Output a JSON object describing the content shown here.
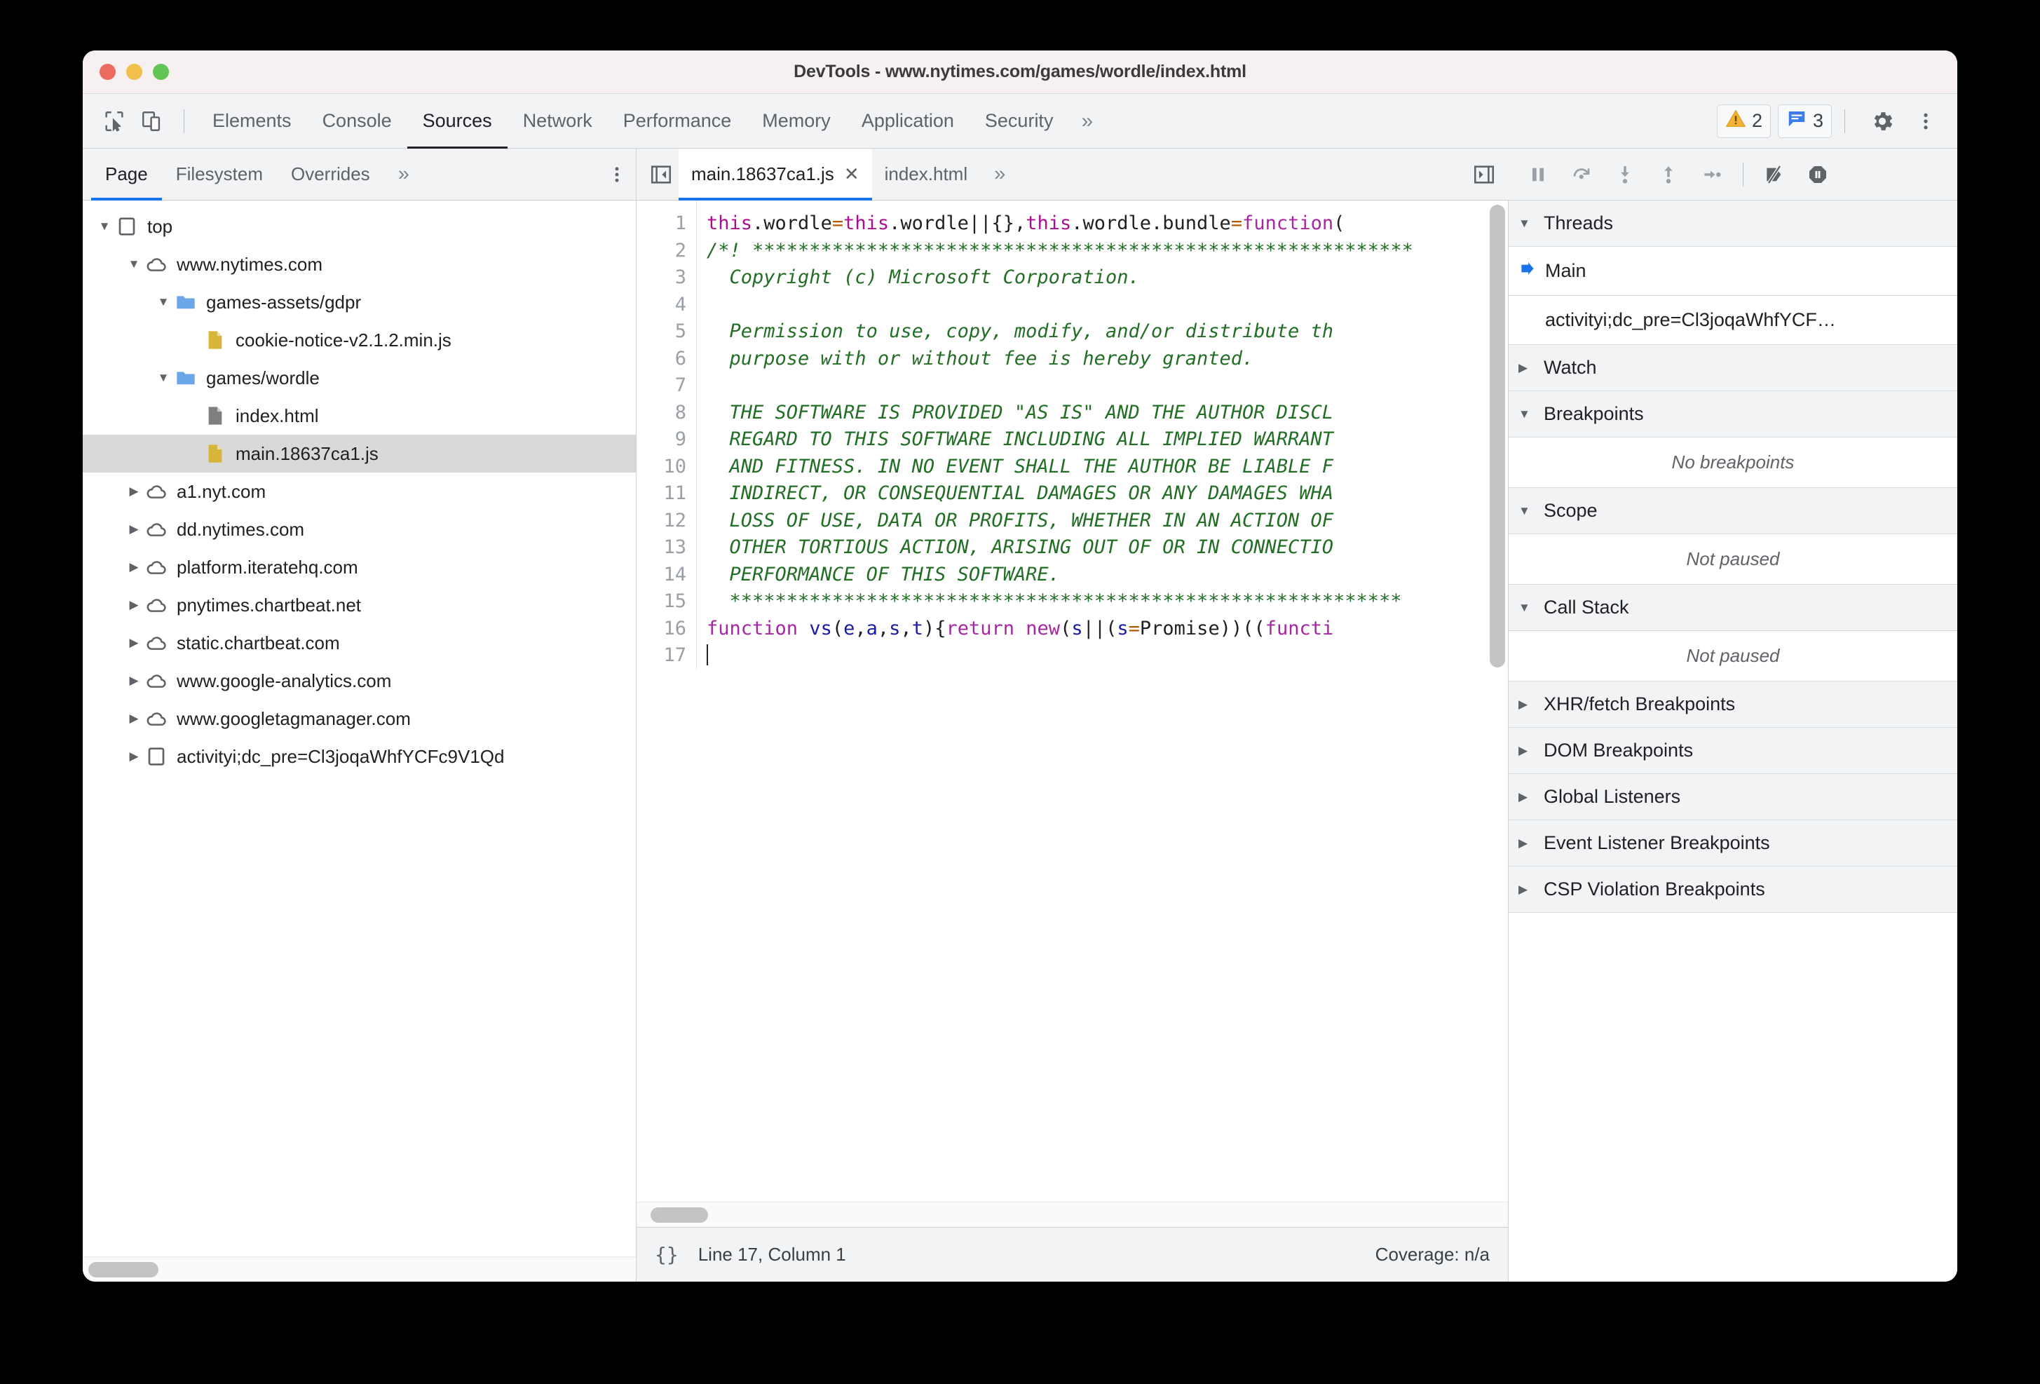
{
  "window": {
    "title": "DevTools - www.nytimes.com/games/wordle/index.html"
  },
  "main_tabs": {
    "inspect_icon": "inspect-cursor-icon",
    "device_icon": "device-toolbar-icon",
    "items": [
      {
        "label": "Elements",
        "active": false
      },
      {
        "label": "Console",
        "active": false
      },
      {
        "label": "Sources",
        "active": true
      },
      {
        "label": "Network",
        "active": false
      },
      {
        "label": "Performance",
        "active": false
      },
      {
        "label": "Memory",
        "active": false
      },
      {
        "label": "Application",
        "active": false
      },
      {
        "label": "Security",
        "active": false
      }
    ],
    "more_label": "»",
    "warning_count": "2",
    "message_count": "3",
    "settings_icon": "gear-icon",
    "more_options_icon": "kebab-menu-icon"
  },
  "navigator": {
    "tabs": [
      {
        "label": "Page",
        "active": true
      },
      {
        "label": "Filesystem",
        "active": false
      },
      {
        "label": "Overrides",
        "active": false
      },
      {
        "label": "»",
        "active": false
      }
    ],
    "more_options_icon": "kebab-menu-icon",
    "tree": [
      {
        "label": "top",
        "icon": "frame-icon",
        "twisty": "down",
        "indent": 0,
        "selected": false
      },
      {
        "label": "www.nytimes.com",
        "icon": "cloud-icon",
        "twisty": "down",
        "indent": 1,
        "selected": false
      },
      {
        "label": "games-assets/gdpr",
        "icon": "folder-icon",
        "twisty": "down",
        "indent": 2,
        "selected": false
      },
      {
        "label": "cookie-notice-v2.1.2.min.js",
        "icon": "js-file-icon",
        "twisty": "none",
        "indent": 3,
        "selected": false
      },
      {
        "label": "games/wordle",
        "icon": "folder-icon",
        "twisty": "down",
        "indent": 2,
        "selected": false
      },
      {
        "label": "index.html",
        "icon": "html-file-icon",
        "twisty": "none",
        "indent": 3,
        "selected": false
      },
      {
        "label": "main.18637ca1.js",
        "icon": "js-file-icon",
        "twisty": "none",
        "indent": 3,
        "selected": true
      },
      {
        "label": "a1.nyt.com",
        "icon": "cloud-icon",
        "twisty": "right",
        "indent": 1,
        "selected": false
      },
      {
        "label": "dd.nytimes.com",
        "icon": "cloud-icon",
        "twisty": "right",
        "indent": 1,
        "selected": false
      },
      {
        "label": "platform.iteratehq.com",
        "icon": "cloud-icon",
        "twisty": "right",
        "indent": 1,
        "selected": false
      },
      {
        "label": "pnytimes.chartbeat.net",
        "icon": "cloud-icon",
        "twisty": "right",
        "indent": 1,
        "selected": false
      },
      {
        "label": "static.chartbeat.com",
        "icon": "cloud-icon",
        "twisty": "right",
        "indent": 1,
        "selected": false
      },
      {
        "label": "www.google-analytics.com",
        "icon": "cloud-icon",
        "twisty": "right",
        "indent": 1,
        "selected": false
      },
      {
        "label": "www.googletagmanager.com",
        "icon": "cloud-icon",
        "twisty": "right",
        "indent": 1,
        "selected": false
      },
      {
        "label": "activityi;dc_pre=Cl3joqaWhfYCFc9V1Qd",
        "icon": "frame-icon",
        "twisty": "right",
        "indent": 1,
        "selected": false
      }
    ]
  },
  "editor": {
    "prev_icon": "show-navigator-icon",
    "next_icon": "show-debugger-icon",
    "tabs": [
      {
        "label": "main.18637ca1.js",
        "active": true,
        "closable": true
      },
      {
        "label": "index.html",
        "active": false,
        "closable": false
      }
    ],
    "more_label": "»",
    "code_lines": [
      {
        "n": "1",
        "tokens": [
          {
            "t": "this",
            "c": "k"
          },
          {
            "t": ".wordle",
            "c": "pl"
          },
          {
            "t": "=",
            "c": "op"
          },
          {
            "t": "this",
            "c": "k"
          },
          {
            "t": ".wordle",
            "c": "pl"
          },
          {
            "t": "||{},",
            "c": "pl"
          },
          {
            "t": "this",
            "c": "k"
          },
          {
            "t": ".wordle.bundle",
            "c": "pl"
          },
          {
            "t": "=",
            "c": "op"
          },
          {
            "t": "function",
            "c": "kk"
          },
          {
            "t": "(",
            "c": "pl"
          }
        ]
      },
      {
        "n": "2",
        "tokens": [
          {
            "t": "/*! **********************************************************",
            "c": "cm"
          }
        ]
      },
      {
        "n": "3",
        "tokens": [
          {
            "t": "  Copyright (c) Microsoft Corporation.",
            "c": "cm"
          }
        ]
      },
      {
        "n": "4",
        "tokens": [
          {
            "t": "",
            "c": "cm"
          }
        ]
      },
      {
        "n": "5",
        "tokens": [
          {
            "t": "  Permission to use, copy, modify, and/or distribute th",
            "c": "cm"
          }
        ]
      },
      {
        "n": "6",
        "tokens": [
          {
            "t": "  purpose with or without fee is hereby granted.",
            "c": "cm"
          }
        ]
      },
      {
        "n": "7",
        "tokens": [
          {
            "t": "",
            "c": "cm"
          }
        ]
      },
      {
        "n": "8",
        "tokens": [
          {
            "t": "  THE SOFTWARE IS PROVIDED \"AS IS\" AND THE AUTHOR DISCL",
            "c": "cm"
          }
        ]
      },
      {
        "n": "9",
        "tokens": [
          {
            "t": "  REGARD TO THIS SOFTWARE INCLUDING ALL IMPLIED WARRANT",
            "c": "cm"
          }
        ]
      },
      {
        "n": "10",
        "tokens": [
          {
            "t": "  AND FITNESS. IN NO EVENT SHALL THE AUTHOR BE LIABLE F",
            "c": "cm"
          }
        ]
      },
      {
        "n": "11",
        "tokens": [
          {
            "t": "  INDIRECT, OR CONSEQUENTIAL DAMAGES OR ANY DAMAGES WHA",
            "c": "cm"
          }
        ]
      },
      {
        "n": "12",
        "tokens": [
          {
            "t": "  LOSS OF USE, DATA OR PROFITS, WHETHER IN AN ACTION OF",
            "c": "cm"
          }
        ]
      },
      {
        "n": "13",
        "tokens": [
          {
            "t": "  OTHER TORTIOUS ACTION, ARISING OUT OF OR IN CONNECTIO",
            "c": "cm"
          }
        ]
      },
      {
        "n": "14",
        "tokens": [
          {
            "t": "  PERFORMANCE OF THIS SOFTWARE.",
            "c": "cm"
          }
        ]
      },
      {
        "n": "15",
        "tokens": [
          {
            "t": "  ***********************************************************",
            "c": "cm"
          }
        ]
      },
      {
        "n": "16",
        "tokens": [
          {
            "t": "function",
            "c": "kk"
          },
          {
            "t": " ",
            "c": "pl"
          },
          {
            "t": "vs",
            "c": "var"
          },
          {
            "t": "(",
            "c": "pl"
          },
          {
            "t": "e",
            "c": "var"
          },
          {
            "t": ",",
            "c": "pl"
          },
          {
            "t": "a",
            "c": "var"
          },
          {
            "t": ",",
            "c": "pl"
          },
          {
            "t": "s",
            "c": "var"
          },
          {
            "t": ",",
            "c": "pl"
          },
          {
            "t": "t",
            "c": "var"
          },
          {
            "t": "){",
            "c": "pl"
          },
          {
            "t": "return",
            "c": "kk"
          },
          {
            "t": " ",
            "c": "pl"
          },
          {
            "t": "new",
            "c": "kk"
          },
          {
            "t": "(",
            "c": "pl"
          },
          {
            "t": "s",
            "c": "var"
          },
          {
            "t": "||(",
            "c": "pl"
          },
          {
            "t": "s",
            "c": "var"
          },
          {
            "t": "=",
            "c": "op"
          },
          {
            "t": "Promise",
            "c": "pl"
          },
          {
            "t": "))((",
            "c": "pl"
          },
          {
            "t": "functi",
            "c": "kk"
          }
        ]
      },
      {
        "n": "17",
        "tokens": [
          {
            "t": "",
            "c": "pl"
          }
        ],
        "caret": true
      }
    ],
    "status": {
      "pretty_print_label": "{}",
      "cursor_position": "Line 17, Column 1",
      "coverage": "Coverage: n/a"
    }
  },
  "debugger": {
    "toolbar": [
      {
        "icon": "pause-icon",
        "name": "resume-script-execution"
      },
      {
        "icon": "step-over-icon",
        "name": "step-over-next-function-call"
      },
      {
        "icon": "step-into-icon",
        "name": "step-into-next-function-call"
      },
      {
        "icon": "step-out-icon",
        "name": "step-out-of-current-function"
      },
      {
        "icon": "step-icon",
        "name": "step"
      },
      {
        "icon": "deactivate-breakpoints-icon",
        "name": "deactivate-breakpoints"
      },
      {
        "icon": "pause-on-exceptions-icon",
        "name": "pause-on-exceptions"
      }
    ],
    "panes": [
      {
        "title": "Threads",
        "expanded": true,
        "rows": [
          {
            "label": "Main",
            "selected": true,
            "arrow": true
          },
          {
            "label": "activityi;dc_pre=Cl3joqaWhfYCF…",
            "selected": false,
            "arrow": false
          }
        ]
      },
      {
        "title": "Watch",
        "expanded": false,
        "empty": null
      },
      {
        "title": "Breakpoints",
        "expanded": true,
        "empty": "No breakpoints"
      },
      {
        "title": "Scope",
        "expanded": true,
        "empty": "Not paused"
      },
      {
        "title": "Call Stack",
        "expanded": true,
        "empty": "Not paused"
      },
      {
        "title": "XHR/fetch Breakpoints",
        "expanded": false,
        "empty": null
      },
      {
        "title": "DOM Breakpoints",
        "expanded": false,
        "empty": null
      },
      {
        "title": "Global Listeners",
        "expanded": false,
        "empty": null
      },
      {
        "title": "Event Listener Breakpoints",
        "expanded": false,
        "empty": null
      },
      {
        "title": "CSP Violation Breakpoints",
        "expanded": false,
        "empty": null
      }
    ]
  },
  "colors": {
    "accent_blue": "#1a73e8",
    "warning_yellow": "#f5a623",
    "folder_blue": "#6ba6e8",
    "js_file_yellow": "#d8b43a",
    "html_file_gray": "#7f7f7f",
    "selected_row": "#d9d9d9",
    "comment_green": "#236e25",
    "keyword_purple": "#a626a4"
  }
}
